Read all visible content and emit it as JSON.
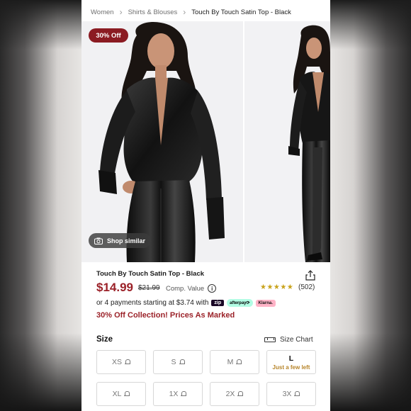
{
  "breadcrumb": {
    "items": [
      "Women",
      "Shirts & Blouses",
      "Touch By Touch Satin Top - Black"
    ]
  },
  "gallery": {
    "badge": "30% Off",
    "shop_similar": "Shop similar"
  },
  "product": {
    "title": "Touch By Touch Satin Top - Black",
    "price": "$14.99",
    "compare_price": "$21.99",
    "comp_value_label": "Comp. Value",
    "rating_stars": "★★★★★",
    "rating_value": 4.5,
    "review_count": "(502)",
    "installments_text": "or 4 payments starting at $3.74 with",
    "payment_methods": [
      "zip",
      "afterpay⟳",
      "Klarna."
    ],
    "promo": "30% Off Collection! Prices As Marked"
  },
  "size": {
    "label": "Size",
    "chart_label": "Size Chart",
    "options": [
      {
        "label": "XS",
        "available": false,
        "note": ""
      },
      {
        "label": "S",
        "available": false,
        "note": ""
      },
      {
        "label": "M",
        "available": false,
        "note": ""
      },
      {
        "label": "L",
        "available": true,
        "note": "Just a few left"
      },
      {
        "label": "XL",
        "available": false,
        "note": ""
      },
      {
        "label": "1X",
        "available": false,
        "note": ""
      },
      {
        "label": "2X",
        "available": false,
        "note": ""
      },
      {
        "label": "3X",
        "available": false,
        "note": ""
      }
    ]
  },
  "colors": {
    "accent": "#9b2128",
    "badge": "#8b1b22",
    "star": "#c8a21a",
    "low_stock": "#b7852a"
  }
}
